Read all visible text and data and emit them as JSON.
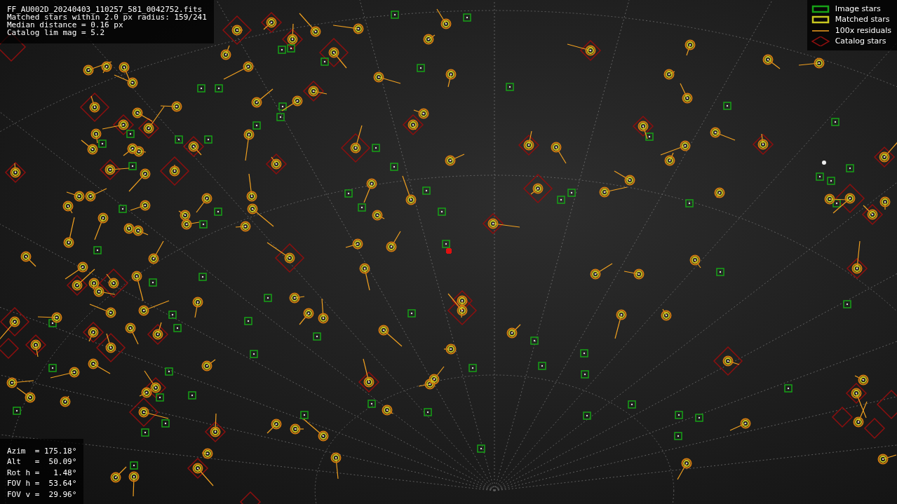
{
  "info": {
    "lines": [
      "FF_AU002D_20240403_110257_581_0042752.fits",
      "Matched stars within 2.0 px radius: 159/241",
      "Median distance = 0.16 px",
      "Catalog lim mag = 5.2"
    ]
  },
  "legend": [
    {
      "kind": "image",
      "label": "Image stars"
    },
    {
      "kind": "matched",
      "label": "Matched stars"
    },
    {
      "kind": "residual",
      "label": "100x residuals"
    },
    {
      "kind": "catalog",
      "label": "Catalog stars"
    }
  ],
  "pointing": {
    "lines": [
      "Azim  = 175.18°",
      "Alt   =  50.09°",
      "Rot h =   1.48°",
      "FOV h =  53.64°",
      "FOV v =  29.96°"
    ]
  }
}
